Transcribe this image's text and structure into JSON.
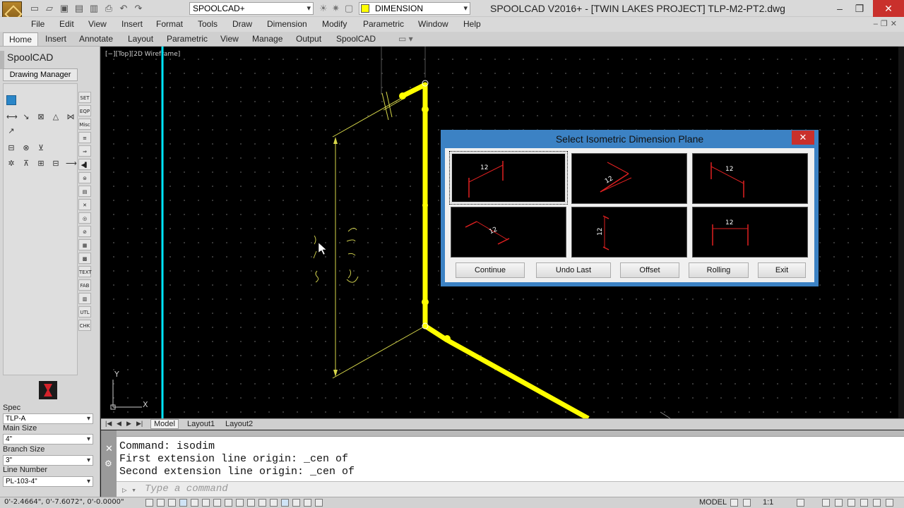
{
  "window": {
    "title": "SPOOLCAD V2016+  - [TWIN LAKES PROJECT]   TLP-M2-PT2.dwg",
    "workspace": "SPOOLCAD+",
    "layer": "DIMENSION",
    "layer_color": "#ffff00"
  },
  "menu": {
    "items": [
      "File",
      "Edit",
      "View",
      "Insert",
      "Format",
      "Tools",
      "Draw",
      "Dimension",
      "Modify",
      "Parametric",
      "Window",
      "Help"
    ]
  },
  "ribbon": {
    "tabs": [
      "Home",
      "Insert",
      "Annotate",
      "Layout",
      "Parametric",
      "View",
      "Manage",
      "Output",
      "SpoolCAD"
    ],
    "active": "Home"
  },
  "panel": {
    "title": "SpoolCAD",
    "drawing_manager": "Drawing Manager",
    "side_buttons": [
      "SET",
      "EQP",
      "Misc",
      "",
      "",
      "",
      "",
      "",
      "",
      "",
      "",
      "",
      "TEXT",
      "FAB",
      "",
      "UTL",
      "CHK"
    ],
    "spec_label": "Spec",
    "spec_value": "TLP-A",
    "main_size_label": "Main Size",
    "main_size_value": "4\"",
    "branch_size_label": "Branch Size",
    "branch_size_value": "3\"",
    "line_number_label": "Line Number",
    "line_number_value": "PL-103-4\""
  },
  "viewport": {
    "label": "[−][Top][2D Wireframe]",
    "ucs_y": "Y",
    "ucs_x": "X"
  },
  "layout_tabs": [
    "Model",
    "Layout1",
    "Layout2"
  ],
  "command": {
    "history": [
      "Command: isodim",
      "First extension line origin: _cen of",
      "Second extension line origin: _cen of"
    ],
    "placeholder": "Type a command"
  },
  "status": {
    "coords": "0'-2.4664\", 0'-7.6072\", 0'-0.0000\"",
    "mode": "MODEL",
    "scale": "1:1"
  },
  "dialog": {
    "title": "Select Isometric Dimension Plane",
    "dim_value": "12",
    "buttons": [
      "Continue",
      "Undo Last",
      "Offset",
      "Rolling",
      "Exit"
    ]
  }
}
